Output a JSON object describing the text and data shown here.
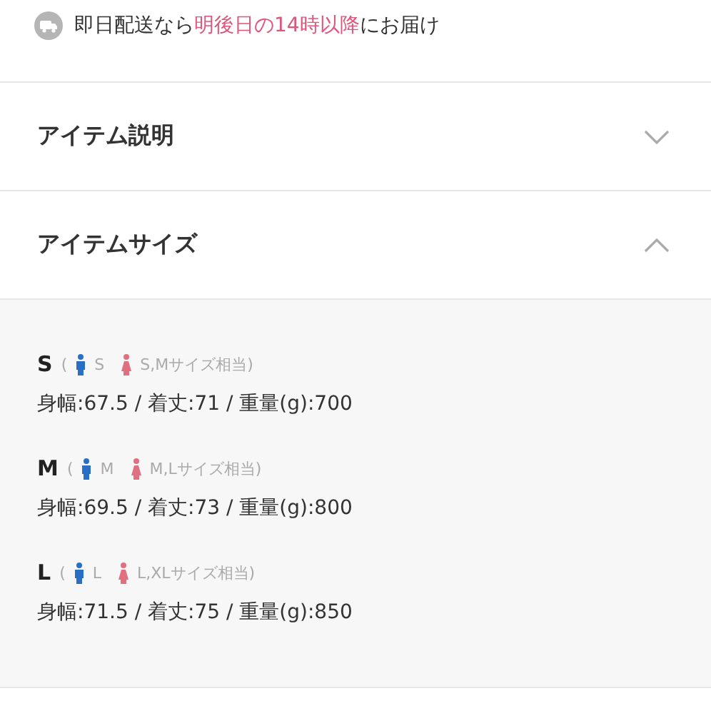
{
  "delivery": {
    "parts": [
      {
        "text": "即日配送なら",
        "highlight": false
      },
      {
        "text": "明後日の14時以降",
        "highlight": true
      },
      {
        "text": "にお届け",
        "highlight": false
      }
    ]
  },
  "sections": [
    {
      "title": "アイテム説明",
      "expanded": false
    },
    {
      "title": "アイテムサイズ",
      "expanded": true
    }
  ],
  "sizes": [
    {
      "size": "S",
      "open": "(",
      "men": "S",
      "women": "S,Mサイズ相当)",
      "specs": "身幅:67.5 / 着丈:71 / 重量(g):700"
    },
    {
      "size": "M",
      "open": "(",
      "men": "M",
      "women": "M,Lサイズ相当)",
      "specs": "身幅:69.5 / 着丈:73 / 重量(g):800"
    },
    {
      "size": "L",
      "open": "(",
      "men": "L",
      "women": "L,XLサイズ相当)",
      "specs": "身幅:71.5 / 着丈:75 / 重量(g):850"
    }
  ]
}
